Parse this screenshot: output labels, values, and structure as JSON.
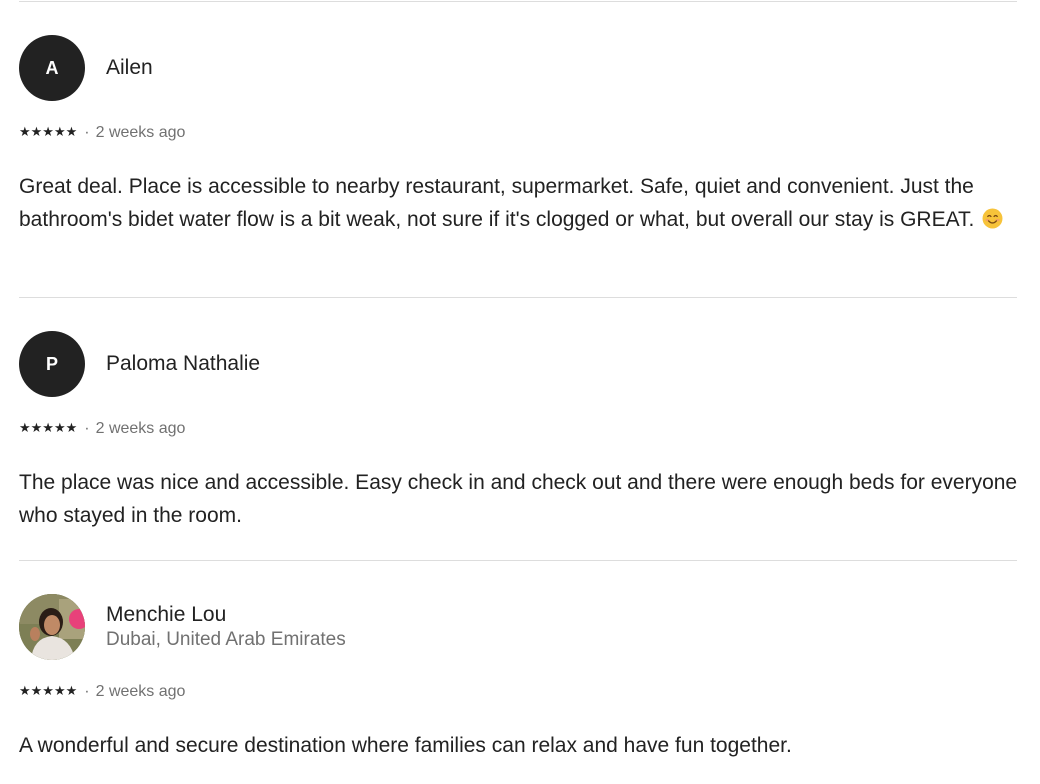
{
  "reviews": [
    {
      "avatar_initial": "A",
      "name": "Ailen",
      "location": "",
      "stars": "★★★★★",
      "separator": "·",
      "date": "2 weeks ago",
      "text": "Great deal. Place is accessible to nearby restaurant, supermarket. Safe, quiet and convenient. Just the bathroom's bidet water flow is a bit weak, not sure if it's clogged or what, but overall our stay is GREAT.",
      "rating": 5
    },
    {
      "avatar_initial": "P",
      "name": "Paloma Nathalie",
      "location": "",
      "stars": "★★★★★",
      "separator": "·",
      "date": "2 weeks ago",
      "text": "The place was nice and accessible. Easy check in and check out and there were enough beds for everyone who stayed in the room.",
      "rating": 5
    },
    {
      "avatar_initial": "",
      "name": "Menchie Lou",
      "location": "Dubai, United Arab Emirates",
      "stars": "★★★★★",
      "separator": "·",
      "date": "2 weeks ago",
      "text": "A wonderful and secure destination where families can relax and have fun together.",
      "rating": 5
    }
  ],
  "colors": {
    "text": "#222222",
    "muted": "#717171",
    "divider": "#dddddd",
    "avatar_bg": "#222222"
  },
  "icons": {
    "emoji": "smiling-face-emoji-icon",
    "star": "star-icon"
  }
}
